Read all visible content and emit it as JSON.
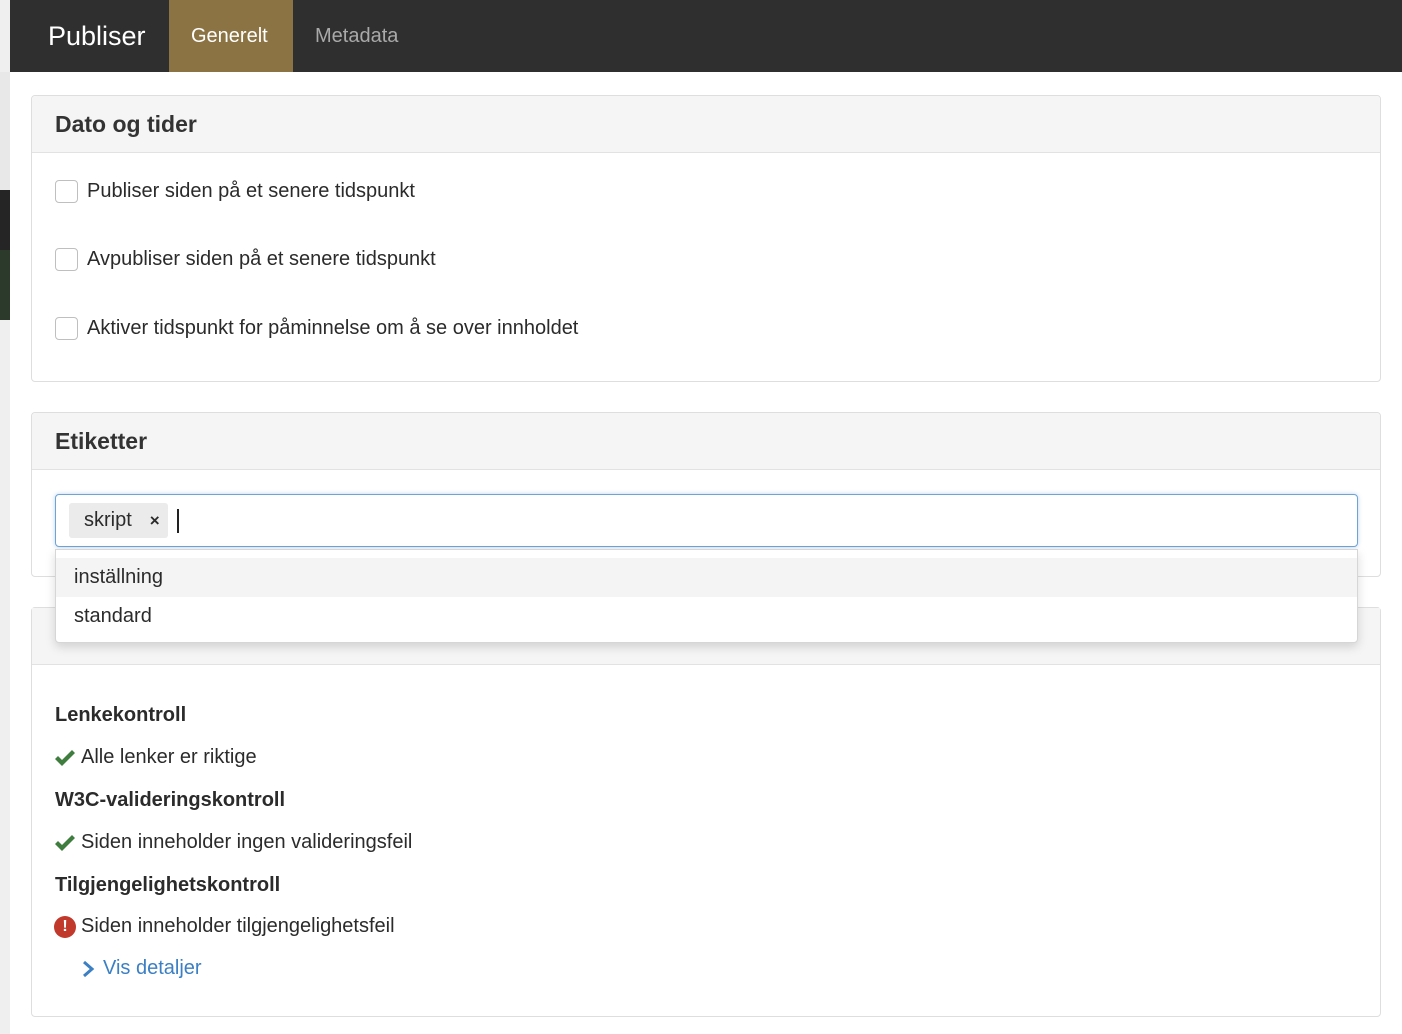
{
  "header": {
    "title": "Publiser",
    "tabs": [
      {
        "label": "Generelt",
        "active": true
      },
      {
        "label": "Metadata",
        "active": false
      }
    ],
    "accent_color": "#8b7344"
  },
  "dates_panel": {
    "title": "Dato og tider",
    "options": [
      {
        "label": "Publiser siden på et senere tidspunkt",
        "checked": false
      },
      {
        "label": "Avpubliser siden på et senere tidspunkt",
        "checked": false
      },
      {
        "label": "Aktiver tidspunkt for påminnelse om å se over innholdet",
        "checked": false
      }
    ]
  },
  "tags_panel": {
    "title": "Etiketter",
    "tags": [
      {
        "label": "skript",
        "remove_symbol": "×"
      }
    ],
    "suggestions": [
      {
        "label": "inställning",
        "highlighted": true
      },
      {
        "label": "standard",
        "highlighted": false
      }
    ]
  },
  "quality_panel": {
    "sections": [
      {
        "heading": "Lenkekontroll",
        "status": "ok",
        "message": "Alle lenker er riktige"
      },
      {
        "heading": "W3C-valideringskontroll",
        "status": "ok",
        "message": "Siden inneholder ingen valideringsfeil"
      },
      {
        "heading": "Tilgjengelighetskontroll",
        "status": "error",
        "message": "Siden inneholder tilgjengelighetsfeil"
      }
    ],
    "details_link": "Vis detaljer",
    "ok_color": "#3f7d3f",
    "error_color": "#c0392b",
    "link_color": "#3b7fc4"
  }
}
